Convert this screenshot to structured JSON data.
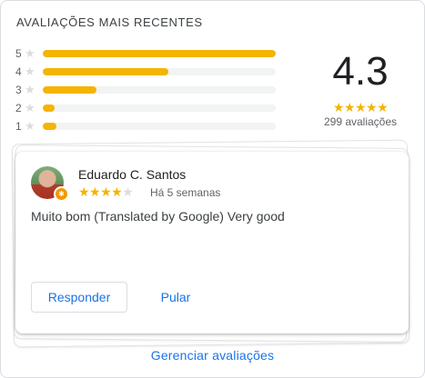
{
  "title": "AVALIAÇÕES MAIS RECENTES",
  "histogram": [
    {
      "label": "5",
      "fraction": 1.0
    },
    {
      "label": "4",
      "fraction": 0.54
    },
    {
      "label": "3",
      "fraction": 0.23
    },
    {
      "label": "2",
      "fraction": 0.05
    },
    {
      "label": "1",
      "fraction": 0.06
    }
  ],
  "summary": {
    "average": "4.3",
    "stars": "★★★★★",
    "count_text": "299 avaliações"
  },
  "review": {
    "reviewer": "Eduardo C. Santos",
    "rating": 4,
    "stars_on": "★★★★",
    "stars_off": "★",
    "time": "Há 5 semanas",
    "text": "Muito bom (Translated by Google) Very good"
  },
  "actions": {
    "reply_label": "Responder",
    "skip_label": "Pular"
  },
  "manage_label": "Gerenciar avaliações",
  "colors": {
    "star": "#f4b400",
    "accent": "#1a73e8",
    "track": "#f1f3f4"
  },
  "icons": {
    "star": "★"
  }
}
